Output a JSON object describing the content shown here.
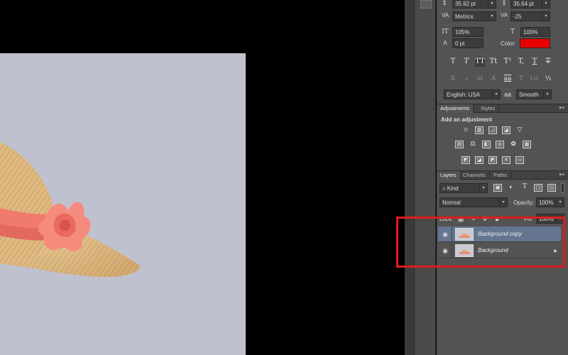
{
  "canvas": {
    "background": "#bfc1cf"
  },
  "character_panel": {
    "leading_value": "35.92 pt",
    "leading_secondary": "35.64 pt",
    "kerning_value": "Metrics",
    "tracking_value": "-25",
    "vertical_scale": "105%",
    "horizontal_scale": "100%",
    "baseline_shift": "0 pt",
    "color_label": "Color:",
    "color_value": "#e80000",
    "type_style_buttons": [
      "T",
      "T",
      "TT",
      "Tt",
      "T¹",
      "T,",
      "T",
      "T"
    ],
    "opentype_buttons": [
      "fi",
      "ℴ",
      "st",
      "A",
      "aa",
      "T",
      "1st",
      "½"
    ],
    "language": "English: USA",
    "aa_label": "aa",
    "antialias": "Smooth"
  },
  "adjustments_panel": {
    "tabs": [
      "Adjustments",
      "Styles"
    ],
    "heading": "Add an adjustment",
    "icons": [
      [
        "brightness-icon",
        "levels-icon",
        "curves-icon",
        "exposure-icon",
        "vibrance-icon"
      ],
      [
        "hue-saturation-icon",
        "color-balance-icon",
        "black-white-icon",
        "photo-filter-icon",
        "channel-mixer-icon",
        "color-lookup-icon"
      ],
      [
        "invert-icon",
        "posterize-icon",
        "threshold-icon",
        "selective-color-icon",
        "gradient-map-icon"
      ]
    ]
  },
  "layers_panel": {
    "tabs": [
      "Layers",
      "Channels",
      "Paths"
    ],
    "filter_kind": "Kind",
    "blend_mode": "Normal",
    "opacity_label": "Opacity:",
    "opacity_value": "100%",
    "lock_label": "Lock:",
    "fill_label": "Fill:",
    "fill_value": "100%",
    "layers": [
      {
        "name": "Background copy",
        "selected": true,
        "locked": false
      },
      {
        "name": "Background",
        "selected": false,
        "locked": true
      }
    ]
  },
  "highlight_color": "#e01b1b"
}
